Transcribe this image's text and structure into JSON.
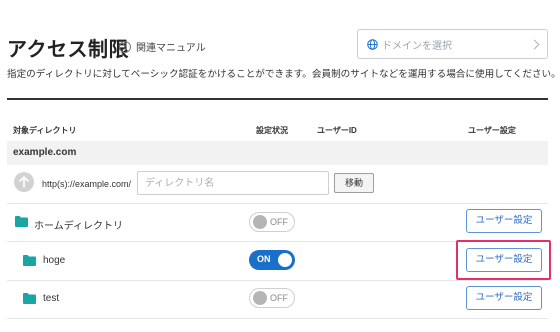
{
  "header": {
    "title": "アクセス制限",
    "manual_link": "関連マニュアル",
    "domain_select_placeholder": "ドメインを選択",
    "description": "指定のディレクトリに対してベーシック認証をかけることができます。会員制のサイトなどを運用する場合に使用してください。"
  },
  "table": {
    "columns": [
      "対象ディレクトリ",
      "設定状況",
      "ユーザーID",
      "ユーザー設定"
    ],
    "domain": "example.com",
    "url_prefix": "http(s)://example.com/",
    "dir_input_placeholder": "ディレクトリ名",
    "move_button": "移動",
    "rows": [
      {
        "name": "ホームディレクトリ",
        "status": "OFF",
        "button": "ユーザー設定"
      },
      {
        "name": "hoge",
        "status": "ON",
        "button": "ユーザー設定"
      },
      {
        "name": "test",
        "status": "OFF",
        "button": "ユーザー設定"
      }
    ]
  },
  "colors": {
    "accent": "#1a6fc9",
    "folder": "#1aa5a5",
    "highlight": "#e0306e"
  }
}
